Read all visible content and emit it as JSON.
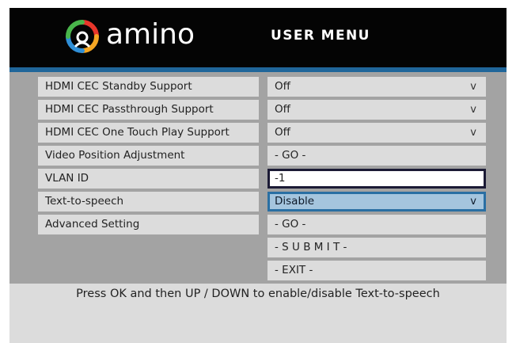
{
  "brand": {
    "name": "amino",
    "logo_colors": [
      "#e8362b",
      "#f5a623",
      "#2f8fd8",
      "#49b54b"
    ]
  },
  "header": {
    "title": "USER MENU"
  },
  "rows": [
    {
      "label": "HDMI CEC Standby Support",
      "value": "Off",
      "arrow": "v"
    },
    {
      "label": "HDMI CEC Passthrough Support",
      "value": "Off",
      "arrow": "v"
    },
    {
      "label": "HDMI CEC One Touch Play Support",
      "value": "Off",
      "arrow": "v"
    },
    {
      "label": "Video Position Adjustment",
      "value": "- GO -"
    },
    {
      "label": "VLAN ID",
      "value": "-1"
    },
    {
      "label": "Text-to-speech",
      "value": "Disable",
      "arrow": "v"
    },
    {
      "label": "Advanced Setting",
      "value": "- GO -"
    }
  ],
  "actions": {
    "submit": "- S U B M I T -",
    "exit": "- EXIT -"
  },
  "footer": {
    "help_text": "Press OK and then UP / DOWN to enable/disable Text-to-speech"
  },
  "colors": {
    "header_bg": "#040404",
    "accent_stripe": "#20669a",
    "panel_bg": "#a3a3a3",
    "cell_bg": "#dcdcdc",
    "selected_bg": "#a5c5de",
    "selected_border": "#2a6fa3"
  }
}
